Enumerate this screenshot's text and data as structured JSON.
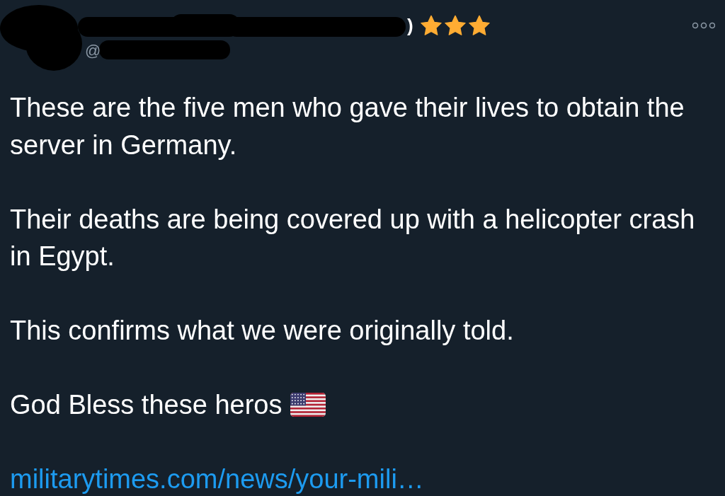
{
  "author": {
    "redacted": true,
    "name": ")",
    "handle": "@"
  },
  "post": {
    "paragraphs": [
      {
        "kind": "text",
        "text": "These are the five men who gave their lives to obtain the server in Germany."
      },
      {
        "kind": "text",
        "text": "Their deaths are being covered up with a helicopter crash in Egypt."
      },
      {
        "kind": "text",
        "text": "This confirms what we were originally told."
      },
      {
        "kind": "text_with_emoji",
        "text": "God Bless these heros"
      }
    ],
    "link": "militarytimes.com/news/your-mili…"
  }
}
